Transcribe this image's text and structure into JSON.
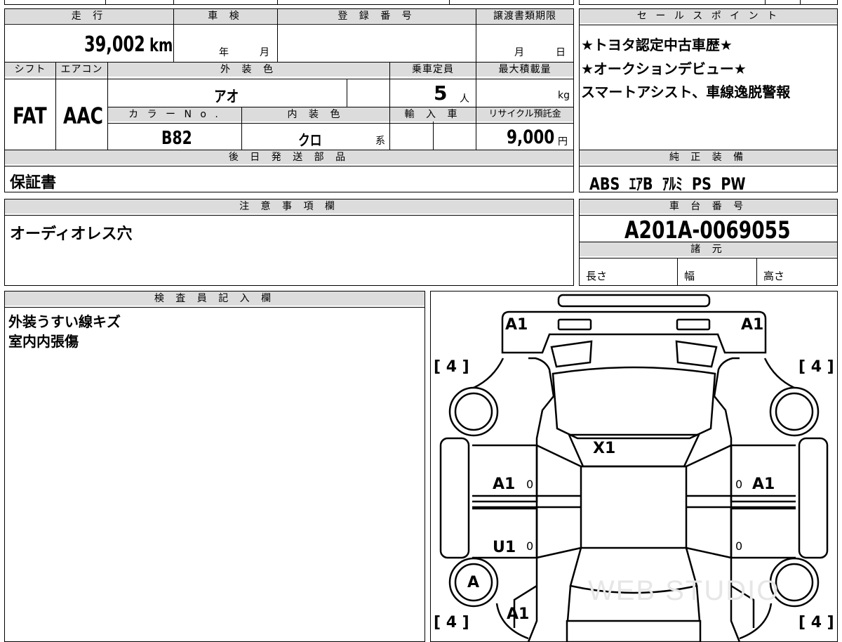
{
  "top": {
    "headers": {
      "mileage": "走 行",
      "inspection": "車 検",
      "registration": "登 録 番 号",
      "transfer_deadline": "譲渡書類期限"
    },
    "mileage_value": "39,002",
    "mileage_unit": "km",
    "inspection_year": "年",
    "inspection_month": "月",
    "transfer_month": "月",
    "transfer_day": "日"
  },
  "specs": {
    "headers": {
      "shift": "シフト",
      "aircon": "エアコン",
      "exterior_color": "外 装 色",
      "capacity": "乗車定員",
      "max_load": "最大積載量",
      "color_no": "カ ラ ー N o .",
      "interior_color": "内 装 色",
      "import": "輸 入 車",
      "recycle": "リサイクル預託金"
    },
    "shift": "FAT",
    "aircon": "AAC",
    "exterior_color": "アオ",
    "capacity": "5",
    "capacity_unit": "人",
    "load_unit": "kg",
    "color_no": "B82",
    "interior_color": "クロ",
    "interior_suffix": "系",
    "recycle_value": "9,000",
    "recycle_unit": "円"
  },
  "sales_points": {
    "header": "セ ー ル ス ポ イ ン ト",
    "lines": [
      "★トヨタ認定中古車歴★",
      "★オークションデビュー★",
      "スマートアシスト、車線逸脱警報"
    ]
  },
  "later_items": {
    "header": "後 日 発 送 部 品",
    "value": "保証書"
  },
  "genuine_equipment": {
    "header": "純 正 装 備",
    "value": "ABS  ｴｱB  ｱﾙﾐ  PS  PW"
  },
  "notes": {
    "header": "注 意 事 項 欄",
    "value": "オーディオレス穴"
  },
  "chassis": {
    "header": "車 台 番 号",
    "value": "A201A-0069055",
    "dims_header": "諸 元",
    "length": "長さ",
    "width": "幅",
    "height": "高さ"
  },
  "inspector": {
    "header": "検 査 員 記 入 欄",
    "lines": [
      "外装うすい線キズ",
      "室内内張傷"
    ]
  },
  "diagram": {
    "front_left_bumper": "A1",
    "front_right_bumper": "A1",
    "windshield": "X1",
    "left_front_door": "A1",
    "right_front_door": "A1",
    "left_rear_door": "U1",
    "left_rear_wheel": "A",
    "rear_left": "A1",
    "tire_fl": "[ 4 ]",
    "tire_fr": "[ 4 ]",
    "tire_rl": "[ 4 ]",
    "tire_rr": "[ 4 ]",
    "zero_lfd": "0",
    "zero_rfd": "0",
    "zero_lrd": "0",
    "zero_rrd": "0"
  }
}
